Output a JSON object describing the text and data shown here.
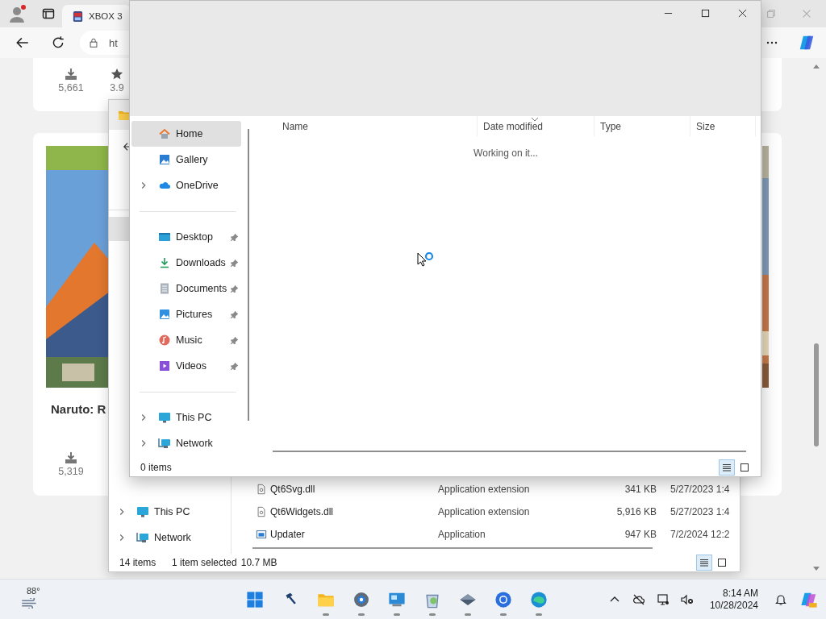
{
  "browser": {
    "tab": {
      "title": "XBOX 3",
      "selected": true
    },
    "address": {
      "value": "ht"
    },
    "stats_card": {
      "stats": [
        {
          "kind": "downloads",
          "value": "5,661"
        },
        {
          "kind": "rating",
          "value": "3.9"
        }
      ]
    },
    "game_card": {
      "title": "Naruto: R",
      "stats": [
        {
          "kind": "downloads",
          "value": "5,319"
        }
      ]
    }
  },
  "back_explorer": {
    "nav": [
      {
        "label": "This PC",
        "kind": "pc",
        "expandable": true
      },
      {
        "label": "Network",
        "kind": "network",
        "expandable": true
      }
    ],
    "files": [
      {
        "name": "Qt6Svg.dll",
        "kind": "dll",
        "type": "Application extension",
        "size": "341 KB",
        "date": "5/27/2023 1:4"
      },
      {
        "name": "Qt6Widgets.dll",
        "kind": "dll",
        "type": "Application extension",
        "size": "5,916 KB",
        "date": "5/27/2023 1:4"
      },
      {
        "name": "Updater",
        "kind": "app",
        "type": "Application",
        "size": "947 KB",
        "date": "7/2/2024 12:2"
      }
    ],
    "status": {
      "count": "14 items",
      "selection": "1 item selected",
      "size": "10.7 MB"
    },
    "views": [
      {
        "kind": "details",
        "selected": true
      },
      {
        "kind": "tiles",
        "selected": false
      }
    ]
  },
  "dialog": {
    "nav_groups": [
      {
        "items": [
          {
            "label": "Home",
            "kind": "home",
            "selected": true,
            "pinned": false,
            "expandable": false
          },
          {
            "label": "Gallery",
            "kind": "gallery",
            "selected": false,
            "pinned": false,
            "expandable": false
          },
          {
            "label": "OneDrive",
            "kind": "cloud",
            "selected": false,
            "pinned": false,
            "expandable": true
          }
        ]
      },
      {
        "items": [
          {
            "label": "Desktop",
            "kind": "desktop",
            "selected": false,
            "pinned": true,
            "expandable": false
          },
          {
            "label": "Downloads",
            "kind": "downloads",
            "selected": false,
            "pinned": true,
            "expandable": false
          },
          {
            "label": "Documents",
            "kind": "documents",
            "selected": false,
            "pinned": true,
            "expandable": false
          },
          {
            "label": "Pictures",
            "kind": "pictures",
            "selected": false,
            "pinned": true,
            "expandable": false
          },
          {
            "label": "Music",
            "kind": "music",
            "selected": false,
            "pinned": true,
            "expandable": false
          },
          {
            "label": "Videos",
            "kind": "videos",
            "selected": false,
            "pinned": true,
            "expandable": false
          }
        ]
      },
      {
        "items": [
          {
            "label": "This PC",
            "kind": "pc",
            "selected": false,
            "pinned": false,
            "expandable": true
          },
          {
            "label": "Network",
            "kind": "network",
            "selected": false,
            "pinned": false,
            "expandable": true
          }
        ]
      }
    ],
    "columns": [
      {
        "label": "Name",
        "sorted": false
      },
      {
        "label": "Date modified",
        "sorted": true
      },
      {
        "label": "Type",
        "sorted": false
      },
      {
        "label": "Size",
        "sorted": false
      }
    ],
    "message": "Working on it...",
    "status": "0 items",
    "views": [
      {
        "kind": "details",
        "selected": true
      },
      {
        "kind": "tiles",
        "selected": false
      }
    ]
  },
  "taskbar": {
    "weather": "88°",
    "apps": [
      {
        "kind": "start",
        "running": false
      },
      {
        "kind": "tool",
        "running": false
      },
      {
        "kind": "folder",
        "running": true
      },
      {
        "kind": "settings",
        "running": true
      },
      {
        "kind": "monitor",
        "running": true
      },
      {
        "kind": "bin",
        "running": true
      },
      {
        "kind": "diamond",
        "running": true
      },
      {
        "kind": "browser",
        "running": true
      },
      {
        "kind": "swirl",
        "running": true
      }
    ],
    "time": "8:14 AM",
    "date": "10/28/2024"
  }
}
